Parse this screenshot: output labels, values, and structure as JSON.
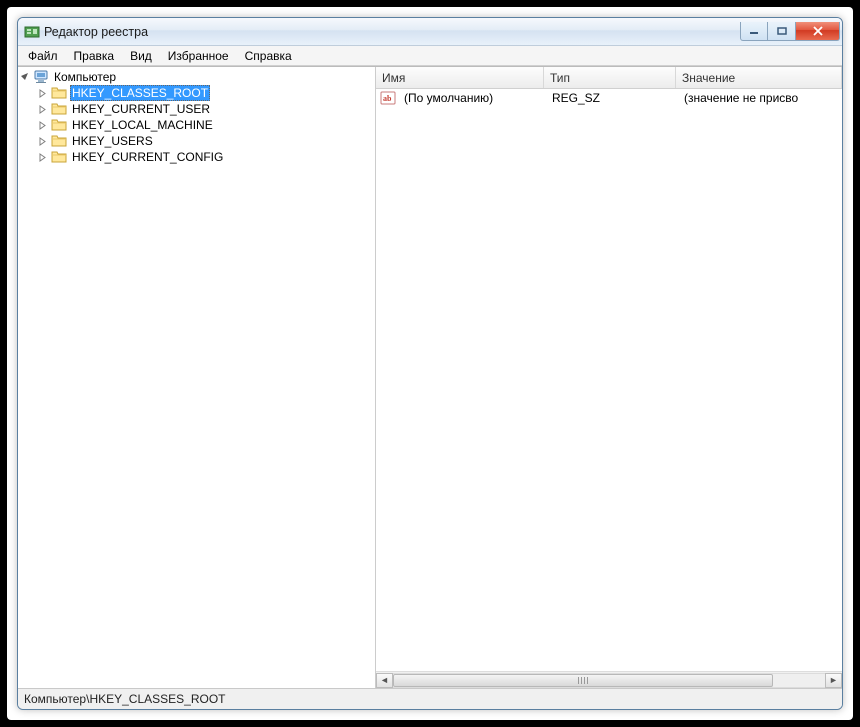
{
  "window": {
    "title": "Редактор реестра"
  },
  "menu": {
    "file": "Файл",
    "edit": "Правка",
    "view": "Вид",
    "favorites": "Избранное",
    "help": "Справка"
  },
  "tree": {
    "root_label": "Компьютер",
    "items": [
      {
        "label": "HKEY_CLASSES_ROOT",
        "selected": true
      },
      {
        "label": "HKEY_CURRENT_USER",
        "selected": false
      },
      {
        "label": "HKEY_LOCAL_MACHINE",
        "selected": false
      },
      {
        "label": "HKEY_USERS",
        "selected": false
      },
      {
        "label": "HKEY_CURRENT_CONFIG",
        "selected": false
      }
    ]
  },
  "columns": {
    "name": "Имя",
    "type": "Тип",
    "value": "Значение"
  },
  "rows": [
    {
      "name": "(По умолчанию)",
      "type": "REG_SZ",
      "value": "(значение не присво"
    }
  ],
  "statusbar": {
    "path": "Компьютер\\HKEY_CLASSES_ROOT"
  }
}
